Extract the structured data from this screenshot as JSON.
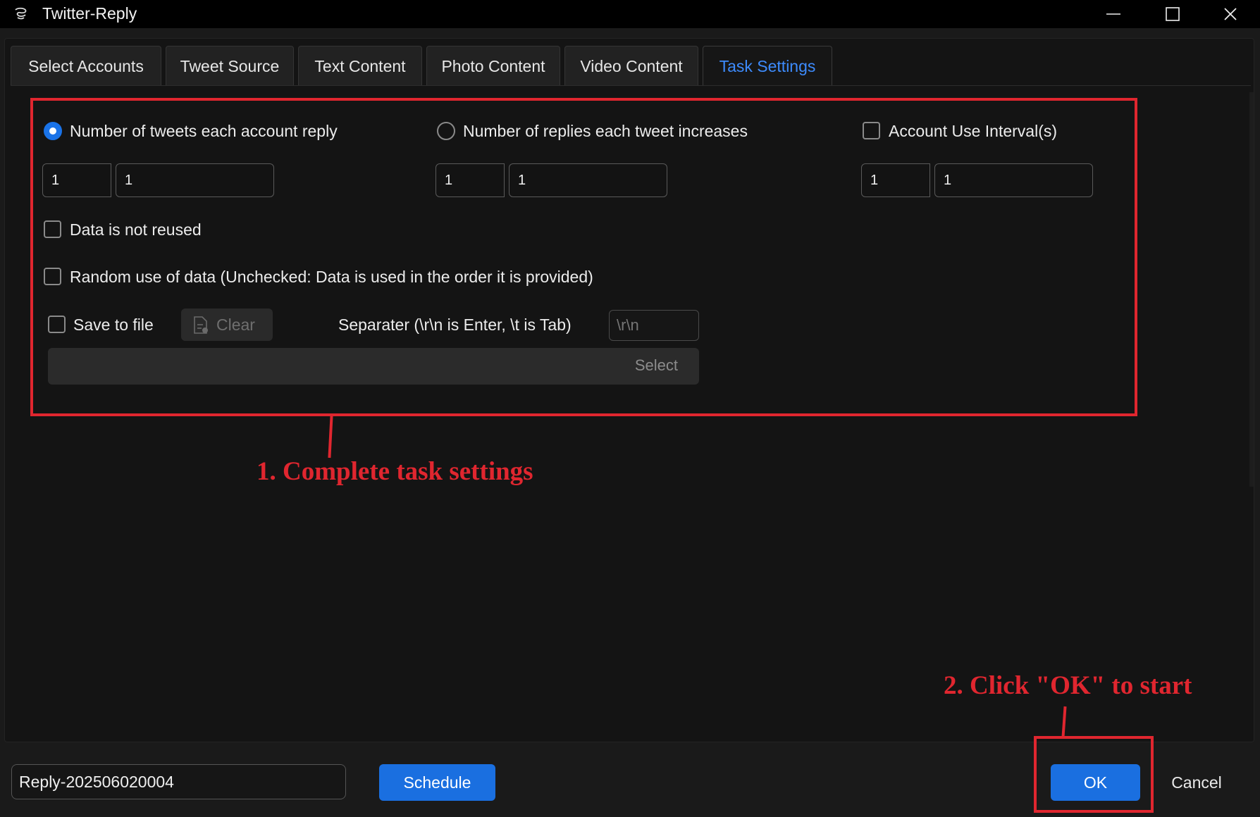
{
  "window": {
    "title": "Twitter-Reply"
  },
  "tabs": [
    {
      "label": "Select Accounts"
    },
    {
      "label": "Tweet Source"
    },
    {
      "label": "Text Content"
    },
    {
      "label": "Photo Content"
    },
    {
      "label": "Video Content"
    },
    {
      "label": "Task Settings",
      "active": true
    }
  ],
  "settings": {
    "tweets_per_account": {
      "label": "Number of tweets each account reply",
      "selected": true,
      "min": "1",
      "max": "1"
    },
    "replies_per_tweet": {
      "label": "Number of replies each tweet increases",
      "selected": false,
      "min": "1",
      "max": "1"
    },
    "account_interval": {
      "label": "Account Use Interval(s)",
      "checked": false,
      "min": "1",
      "max": "1"
    },
    "data_not_reused": {
      "label": "Data is not reused",
      "checked": false
    },
    "random_use": {
      "label": "Random use of data (Unchecked: Data is used in the order it is provided)",
      "checked": false
    },
    "save_to_file": {
      "label": "Save to file",
      "checked": false
    },
    "clear_label": "Clear",
    "separator_label": "Separater (\\r\\n is Enter, \\t is Tab)",
    "separator_placeholder": "\\r\\n",
    "select_label": "Select"
  },
  "annotations": {
    "step1": "1. Complete task settings",
    "step2": "2. Click \"OK\" to start",
    "color": "#e0262f"
  },
  "footer": {
    "task_name": "Reply-202506020004",
    "schedule_label": "Schedule",
    "ok_label": "OK",
    "cancel_label": "Cancel"
  },
  "colors": {
    "accent": "#1a6fe0",
    "active_tab": "#3d8bfd",
    "background": "#141414"
  }
}
